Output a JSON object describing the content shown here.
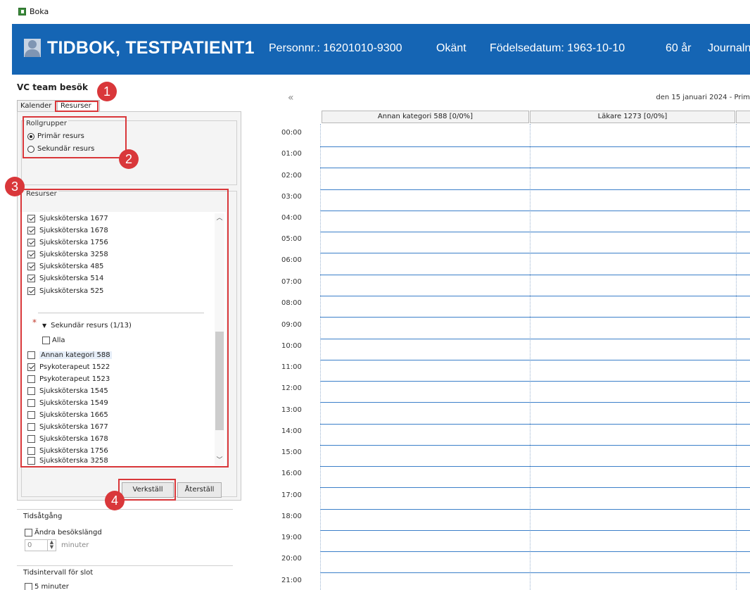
{
  "window": {
    "title": "Boka"
  },
  "header": {
    "patient_name": "TIDBOK, TESTPATIENT1",
    "personnr": "Personnr.: 16201010-9300",
    "gender": "Okänt",
    "birthdate": "Födelsedatum: 1963-10-10",
    "age": "60 år",
    "journal": "Journaln"
  },
  "left": {
    "title": "VC team besök",
    "tabs": [
      "Kalender",
      "Resurser"
    ],
    "rollgrupper": {
      "label": "Rollgrupper",
      "options": [
        "Primär resurs",
        "Sekundär resurs"
      ],
      "selected": "Primär resurs"
    },
    "resurser": {
      "label": "Resurser",
      "primary_items": [
        {
          "label": "Sjuksköterska 1677",
          "checked": true
        },
        {
          "label": "Sjuksköterska 1678",
          "checked": true
        },
        {
          "label": "Sjuksköterska 1756",
          "checked": true
        },
        {
          "label": "Sjuksköterska 3258",
          "checked": true
        },
        {
          "label": "Sjuksköterska 485",
          "checked": true
        },
        {
          "label": "Sjuksköterska 514",
          "checked": true
        },
        {
          "label": "Sjuksköterska 525",
          "checked": true
        }
      ],
      "secondary_header": "Sekundär resurs (1/13)",
      "all_label": "Alla",
      "secondary_items": [
        {
          "label": "Annan kategori 588",
          "checked": false
        },
        {
          "label": "Psykoterapeut 1522",
          "checked": true
        },
        {
          "label": "Psykoterapeut 1523",
          "checked": false
        },
        {
          "label": "Sjuksköterska 1545",
          "checked": false
        },
        {
          "label": "Sjuksköterska 1549",
          "checked": false
        },
        {
          "label": "Sjuksköterska 1665",
          "checked": false
        },
        {
          "label": "Sjuksköterska 1677",
          "checked": false
        },
        {
          "label": "Sjuksköterska 1678",
          "checked": false
        },
        {
          "label": "Sjuksköterska 1756",
          "checked": false
        },
        {
          "label": "Sjuksköterska 3258",
          "checked": false
        }
      ]
    },
    "buttons": {
      "apply": "Verkställ",
      "reset": "Återställ"
    },
    "tidsatgang": {
      "label": "Tidsåtgång",
      "checkbox": "Ändra besökslängd",
      "value": "0",
      "unit": "minuter"
    },
    "tidsintervall": {
      "label": "Tidsintervall för slot",
      "option": "5 minuter"
    }
  },
  "callouts": [
    "1",
    "2",
    "3",
    "4"
  ],
  "calendar": {
    "date_label": "den 15 januari 2024 - Prim",
    "columns": [
      "Annan kategori 588  [0/0%]",
      "Läkare 1273  [0/0%]"
    ],
    "times": [
      "00:00",
      "01:00",
      "02:00",
      "03:00",
      "04:00",
      "05:00",
      "06:00",
      "07:00",
      "08:00",
      "09:00",
      "10:00",
      "11:00",
      "12:00",
      "13:00",
      "14:00",
      "15:00",
      "16:00",
      "17:00",
      "18:00",
      "19:00",
      "20:00",
      "21:00"
    ]
  }
}
